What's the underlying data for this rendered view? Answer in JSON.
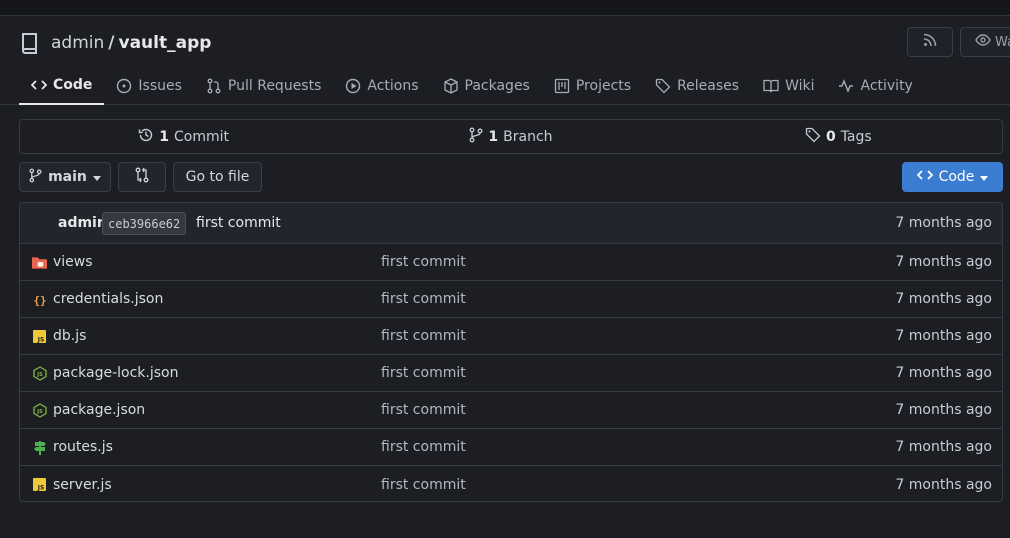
{
  "repo": {
    "owner": "admin",
    "separator": "/",
    "name": "vault_app"
  },
  "header": {
    "watch_label": "Wa"
  },
  "tabs": [
    {
      "label": "Code",
      "icon": "code-icon"
    },
    {
      "label": "Issues",
      "icon": "issue-icon"
    },
    {
      "label": "Pull Requests",
      "icon": "pull-request-icon"
    },
    {
      "label": "Actions",
      "icon": "play-icon"
    },
    {
      "label": "Packages",
      "icon": "package-icon"
    },
    {
      "label": "Projects",
      "icon": "project-icon"
    },
    {
      "label": "Releases",
      "icon": "tag-icon"
    },
    {
      "label": "Wiki",
      "icon": "book-icon"
    },
    {
      "label": "Activity",
      "icon": "pulse-icon"
    }
  ],
  "stats": {
    "commits": {
      "count": "1",
      "label": "Commit"
    },
    "branches": {
      "count": "1",
      "label": "Branch"
    },
    "tags": {
      "count": "0",
      "label": "Tags"
    }
  },
  "toolbar": {
    "branch": "main",
    "go_to_file": "Go to file",
    "code_label": "Code"
  },
  "latest_commit": {
    "author": "admin",
    "sha": "ceb3966e62",
    "message": "first commit",
    "time": "7 months ago"
  },
  "files": [
    {
      "name": "views",
      "commit": "first commit",
      "time": "7 months ago",
      "icon": "folder-icon"
    },
    {
      "name": "credentials.json",
      "commit": "first commit",
      "time": "7 months ago",
      "icon": "json-icon"
    },
    {
      "name": "db.js",
      "commit": "first commit",
      "time": "7 months ago",
      "icon": "js-icon"
    },
    {
      "name": "package-lock.json",
      "commit": "first commit",
      "time": "7 months ago",
      "icon": "node-icon"
    },
    {
      "name": "package.json",
      "commit": "first commit",
      "time": "7 months ago",
      "icon": "node-icon"
    },
    {
      "name": "routes.js",
      "commit": "first commit",
      "time": "7 months ago",
      "icon": "signpost-icon"
    },
    {
      "name": "server.js",
      "commit": "first commit",
      "time": "7 months ago",
      "icon": "js-icon"
    }
  ],
  "colors": {
    "accent": "#3b7dd0",
    "folder": "#e8664f",
    "json": "#e6a23c",
    "js": "#f0c93a",
    "node": "#7cba3d",
    "routes": "#4caf50"
  }
}
